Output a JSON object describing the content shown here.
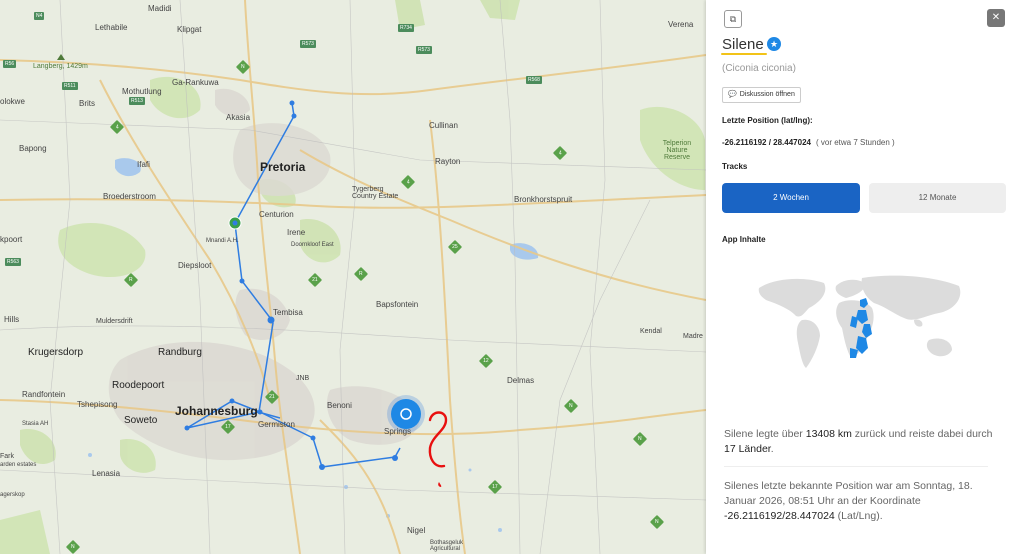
{
  "map": {
    "places": {
      "madidi": "Madidi",
      "lethabile": "Lethabile",
      "klipgat": "Klipgat",
      "garankuwa": "Ga-Rankuwa",
      "mothutlung": "Mothutlung",
      "brits": "Brits",
      "olokwe": "olokwe",
      "langberg": "Langberg, 1429m",
      "akasia": "Akasia",
      "bapong": "Bapong",
      "ifafi": "Ifafi",
      "pretoria": "Pretoria",
      "broederstroom": "Broederstroom",
      "mnandi": "Mnandi A.H.",
      "centurion": "Centurion",
      "irene": "Irene",
      "doornkloof": "Doornkloof East",
      "kpoort": "kpoort",
      "diepsloot": "Diepsloot",
      "hills": "Hills",
      "muldersdrift": "Muldersdrift",
      "tembisa": "Tembisa",
      "krugersdorp": "Krugersdorp",
      "randburg": "Randburg",
      "roodepoort": "Roodepoort",
      "randfontein": "Randfontein",
      "tshepisong": "Tshepisong",
      "johannesburg": "Johannesburg",
      "soweto": "Soweto",
      "stasia": "Stasia AH",
      "fark": "Fark",
      "arden": "arden estates",
      "lenasia": "Lenasia",
      "agerskop": "agerskop",
      "germiston": "Germiston",
      "benoni": "Benoni",
      "springs": "Springs",
      "delmas": "Delmas",
      "nigel": "Nigel",
      "bothasgeluk": "Bothasgeluk Agricultural",
      "bapsfontein": "Bapsfontein",
      "jnb": "JNB",
      "cullinan": "Cullinan",
      "rayton": "Rayton",
      "tygerberg": "Tygerberg Country Estate",
      "bronkhorstspruit": "Bronkhorstspruit",
      "verena": "Verena",
      "kendal": "Kendal",
      "madre": "Madre",
      "telperion": "Telperion Nature Reserve"
    }
  },
  "panel": {
    "bird_name": "Silene",
    "scientific_name": "(Ciconia ciconia)",
    "discussion_label": "Diskussion öffnen",
    "last_position_label": "Letzte Position (lat/lng):",
    "last_position_value": "-26.2116192 / 28.447024",
    "last_position_ago": "( vor etwa 7 Stunden )",
    "tracks_label": "Tracks",
    "tab_2w": "2 Wochen",
    "tab_12m": "12 Monate",
    "app_content_label": "App Inhalte",
    "stat_prefix": "Silene legte über ",
    "stat_distance": "13408 km",
    "stat_mid": " zurück und reiste dabei durch ",
    "stat_countries": "17 Länder",
    "stat_end": ".",
    "last_sentence_prefix": "Silenes letzte bekannte Position war am Sonntag, 18. Januar 2026, 08:51 Uhr an der Koordinate ",
    "last_sentence_coord": "-26.2116192/28.447024",
    "last_sentence_suffix": " (Lat/Lng).",
    "colors": {
      "accent": "#1a64c4",
      "star": "#1e88e5",
      "underline": "#f2c318",
      "track": "#2f7de1"
    }
  }
}
